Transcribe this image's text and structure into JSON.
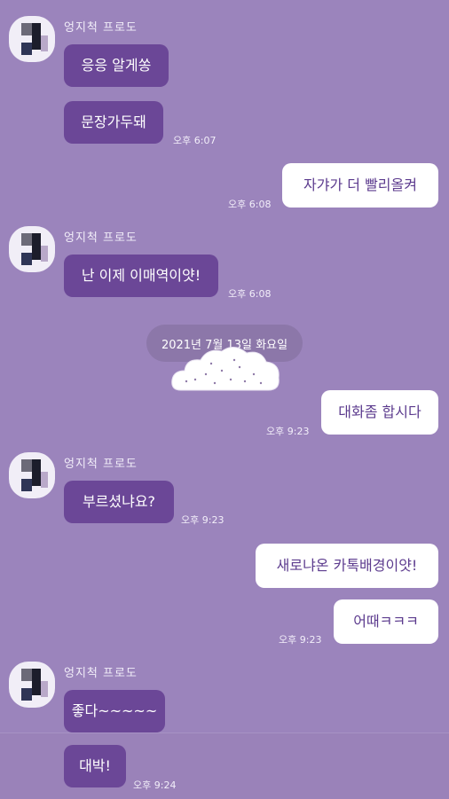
{
  "contact": {
    "name": "엉지척 프로도"
  },
  "messages": [
    {
      "side": "in",
      "text": "응응 알게쏭"
    },
    {
      "side": "in",
      "text": "문장가두돼",
      "time": "오후 6:07"
    },
    {
      "side": "out",
      "text": "자갸가 더 빨리올켜",
      "time": "오후 6:08"
    },
    {
      "side": "in",
      "text": "난 이제 이매역이얏!",
      "time": "오후 6:08"
    },
    {
      "date": "2021년 7월 13일 화요일"
    },
    {
      "side": "out",
      "text": "대화좀 합시다",
      "time": "오후 9:23"
    },
    {
      "side": "in",
      "text": "부르셨냐요?",
      "time": "오후 9:23"
    },
    {
      "side": "out",
      "text": "새로냐온 카톡배경이얏!"
    },
    {
      "side": "out",
      "text": "어때ㅋㅋㅋ",
      "time": "오후 9:23"
    },
    {
      "side": "in",
      "text": "좋다~~~~~"
    },
    {
      "side": "in",
      "text": "대박!",
      "time": "오후 9:24"
    }
  ],
  "colors": {
    "background": "#9b84bc",
    "incoming_bubble": "#6b4797",
    "outgoing_bubble": "#ffffff",
    "outgoing_text": "#5c3b8e"
  }
}
